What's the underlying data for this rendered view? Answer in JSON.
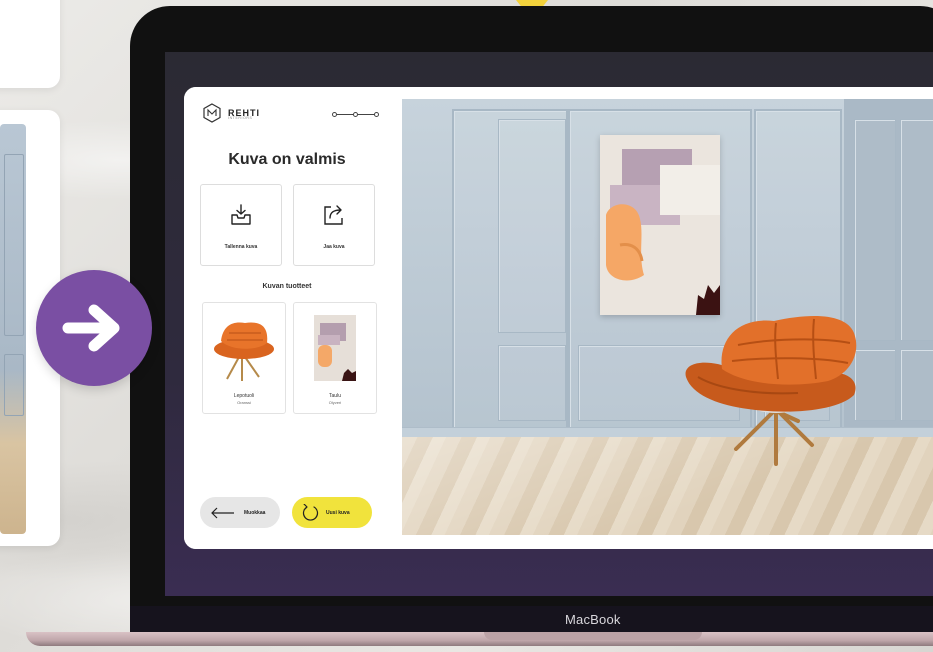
{
  "app": {
    "brand": {
      "name": "REHTI",
      "subtitle": "INTERIORS"
    },
    "title": "Kuva on valmis",
    "actions": [
      {
        "label": "Tallenna kuva",
        "icon": "download-tray-icon"
      },
      {
        "label": "Jaa kuva",
        "icon": "share-icon"
      }
    ],
    "products_heading": "Kuvan tuotteet",
    "products": [
      {
        "name": "Lepotuoli",
        "sub": "Oranssi"
      },
      {
        "name": "Taulu",
        "sub": "Olyveri"
      }
    ],
    "back_button": "Muokkaa",
    "new_button": "Uusi kuva"
  },
  "device": {
    "label": "MacBook"
  },
  "colors": {
    "accent_yellow": "#f1e33c",
    "arrow_purple": "#7a4fa3",
    "chair_orange": "#d9641f"
  }
}
